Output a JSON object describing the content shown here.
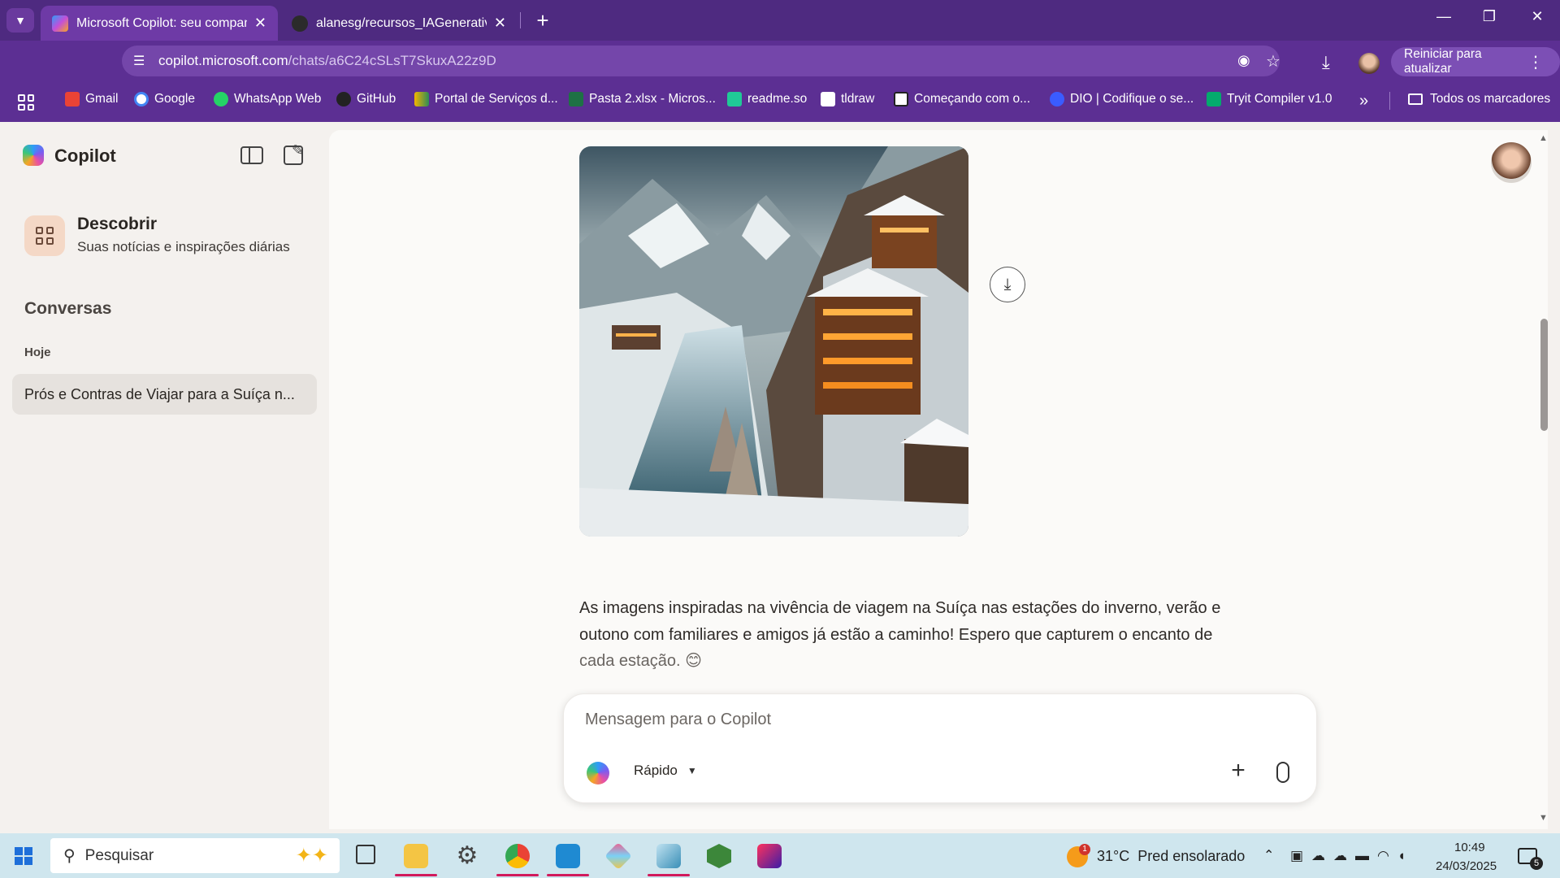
{
  "browser": {
    "tabs": [
      {
        "title": "Microsoft Copilot: seu companh",
        "active": true
      },
      {
        "title": "alanesg/recursos_IAGenerativa_",
        "active": false
      }
    ],
    "url_host": "copilot.microsoft.com",
    "url_path": "/chats/a6C24cSLsT7SkuxA22z9D",
    "restart_label": "Reiniciar para atualizar",
    "bookmarks": [
      {
        "label": "Gmail",
        "color": "#ea4335"
      },
      {
        "label": "Google",
        "color": "#4285f4"
      },
      {
        "label": "WhatsApp Web",
        "color": "#25d366"
      },
      {
        "label": "GitHub",
        "color": "#222222"
      },
      {
        "label": "Portal de Serviços d...",
        "color": "#f2b600"
      },
      {
        "label": "Pasta 2.xlsx - Micros...",
        "color": "#1e7145"
      },
      {
        "label": "readme.so",
        "color": "#20c997"
      },
      {
        "label": "tldraw",
        "color": "#ffffff"
      },
      {
        "label": "Começando com o...",
        "color": "#ffffff"
      },
      {
        "label": "DIO | Codifique o se...",
        "color": "#3a5cff"
      },
      {
        "label": "Tryit Compiler v1.0",
        "color": "#04aa6d"
      }
    ],
    "all_bookmarks_label": "Todos os marcadores"
  },
  "sidebar": {
    "brand": "Copilot",
    "discover_title": "Descobrir",
    "discover_subtitle": "Suas notícias e inspirações diárias",
    "conversations_title": "Conversas",
    "today_label": "Hoje",
    "conversation_item": "Prós e Contras de Viajar para a Suíça n..."
  },
  "main": {
    "image_alt": "Vilarejo suíço nevado com rio e chalés iluminados",
    "message_lines": [
      "As imagens inspiradas na vivência de viagem na Suíça nas estações do inverno, verão e",
      "outono com familiares e amigos já estão a caminho! Espero que capturem o encanto de",
      "cada estação. 😊"
    ],
    "input_placeholder": "Mensagem para o Copilot",
    "mode_label": "Rápido"
  },
  "taskbar": {
    "search_placeholder": "Pesquisar",
    "weather": "31°C  Pred ensolarado",
    "weather_badge": "1",
    "time": "10:49",
    "date": "24/03/2025",
    "notifications": "5"
  }
}
